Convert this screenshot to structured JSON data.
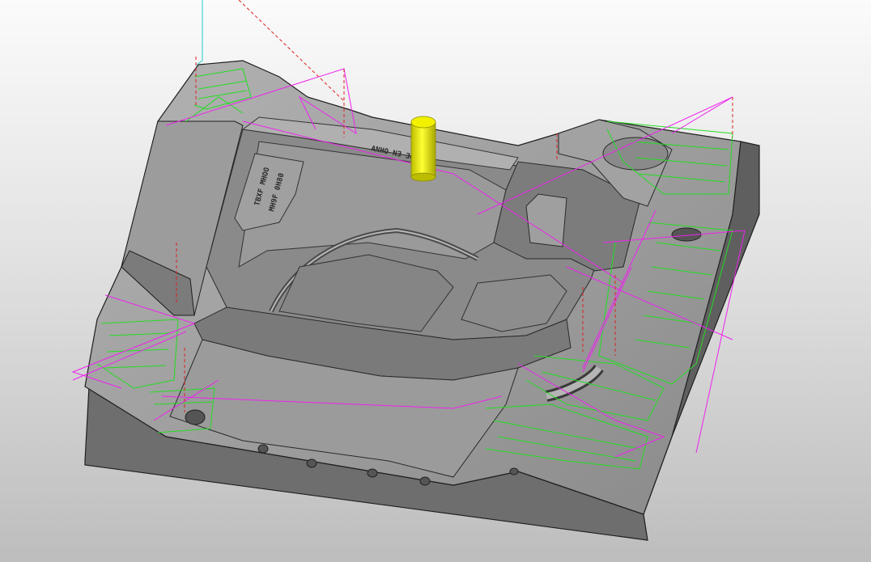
{
  "viewport": {
    "background_top": "#fbfbfb",
    "background_bottom": "#bdbdbd"
  },
  "part": {
    "body_color": "#8f8f8f",
    "top_color": "#a6a6a6",
    "side_color": "#5e5e5e",
    "edge_color": "#1e1e1e",
    "engraved_text": [
      "ANHO N∃ ∃QAM",
      "TBXF MHOO",
      "MH9F 0H80"
    ]
  },
  "tool": {
    "name": "cutting-tool",
    "color": "#e4e400"
  },
  "toolpath": {
    "cut_color": "#22dd22",
    "link_color": "#ee22ee",
    "retract_color": "#dd2222",
    "axis_color": "#22cccc"
  }
}
